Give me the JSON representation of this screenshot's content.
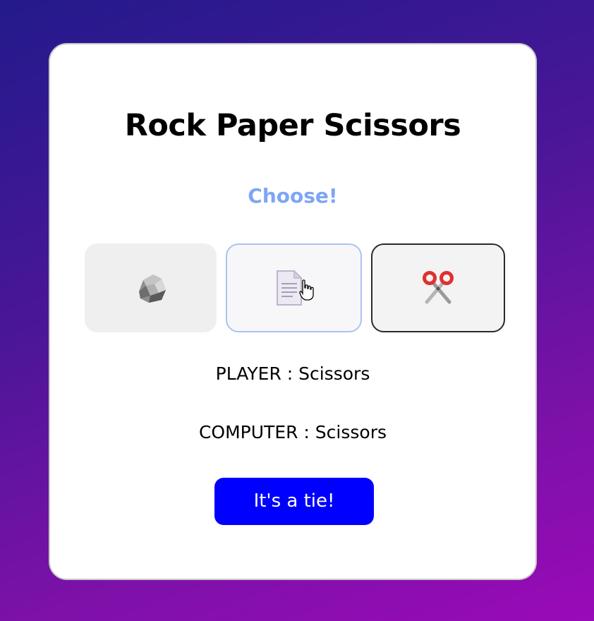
{
  "game": {
    "title": "Rock Paper Scissors",
    "prompt": "Choose!",
    "choices": [
      {
        "id": "rock",
        "icon": "rock-icon"
      },
      {
        "id": "paper",
        "icon": "paper-icon"
      },
      {
        "id": "scissors",
        "icon": "scissors-icon"
      }
    ],
    "player_label": "PLAYER : Scissors",
    "computer_label": "COMPUTER : Scissors",
    "result": "It's a tie!"
  },
  "colors": {
    "background_start": "#231a8c",
    "background_end": "#9a0ab8",
    "prompt": "#7ea5f5",
    "result_button": "#0000ff",
    "scissors_handles": "#e03030"
  }
}
